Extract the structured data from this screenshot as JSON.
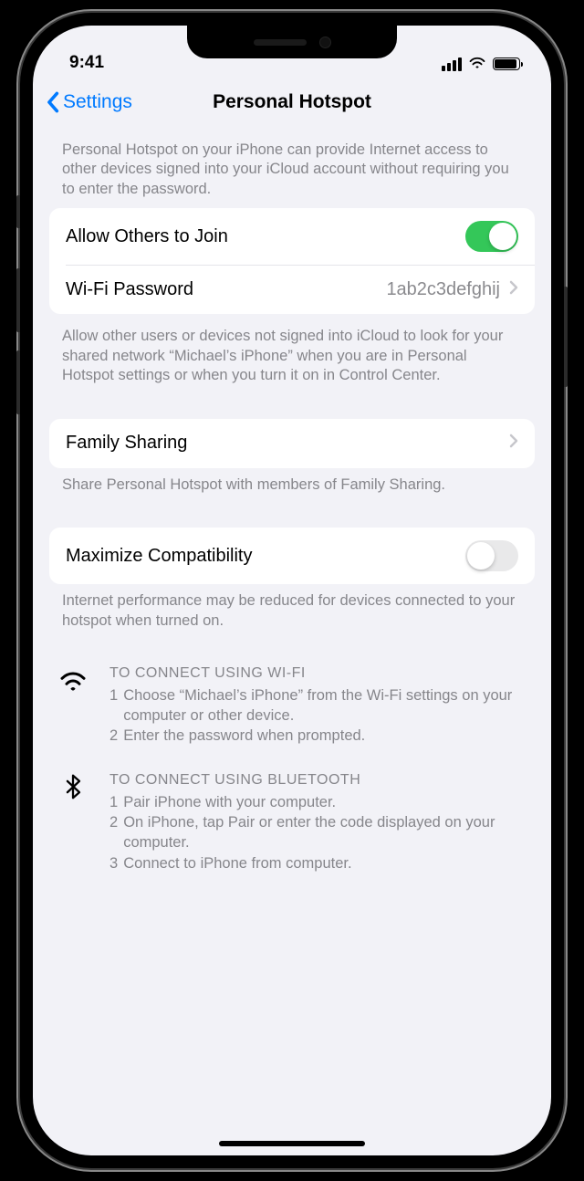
{
  "status": {
    "time": "9:41"
  },
  "nav": {
    "back_label": "Settings",
    "title": "Personal Hotspot"
  },
  "header_desc": "Personal Hotspot on your iPhone can provide Internet access to other devices signed into your iCloud account without requiring you to enter the password.",
  "allow": {
    "label": "Allow Others to Join",
    "on": true
  },
  "wifi_password": {
    "label": "Wi-Fi Password",
    "value": "1ab2c3defghij"
  },
  "allow_desc": "Allow other users or devices not signed into iCloud to look for your shared network “Michael’s iPhone” when you are in Personal Hotspot settings or when you turn it on in Control Center.",
  "family": {
    "label": "Family Sharing",
    "desc": "Share Personal Hotspot with members of Family Sharing."
  },
  "compat": {
    "label": "Maximize Compatibility",
    "on": false,
    "desc": "Internet performance may be reduced for devices connected to your hotspot when turned on."
  },
  "instr_wifi": {
    "title": "TO CONNECT USING WI-FI",
    "step1": "Choose “Michael’s iPhone” from the Wi-Fi settings on your computer or other device.",
    "step2": "Enter the password when prompted."
  },
  "instr_bt": {
    "title": "TO CONNECT USING BLUETOOTH",
    "step1": "Pair iPhone with your computer.",
    "step2": "On iPhone, tap Pair or enter the code displayed on your computer.",
    "step3": "Connect to iPhone from computer."
  }
}
